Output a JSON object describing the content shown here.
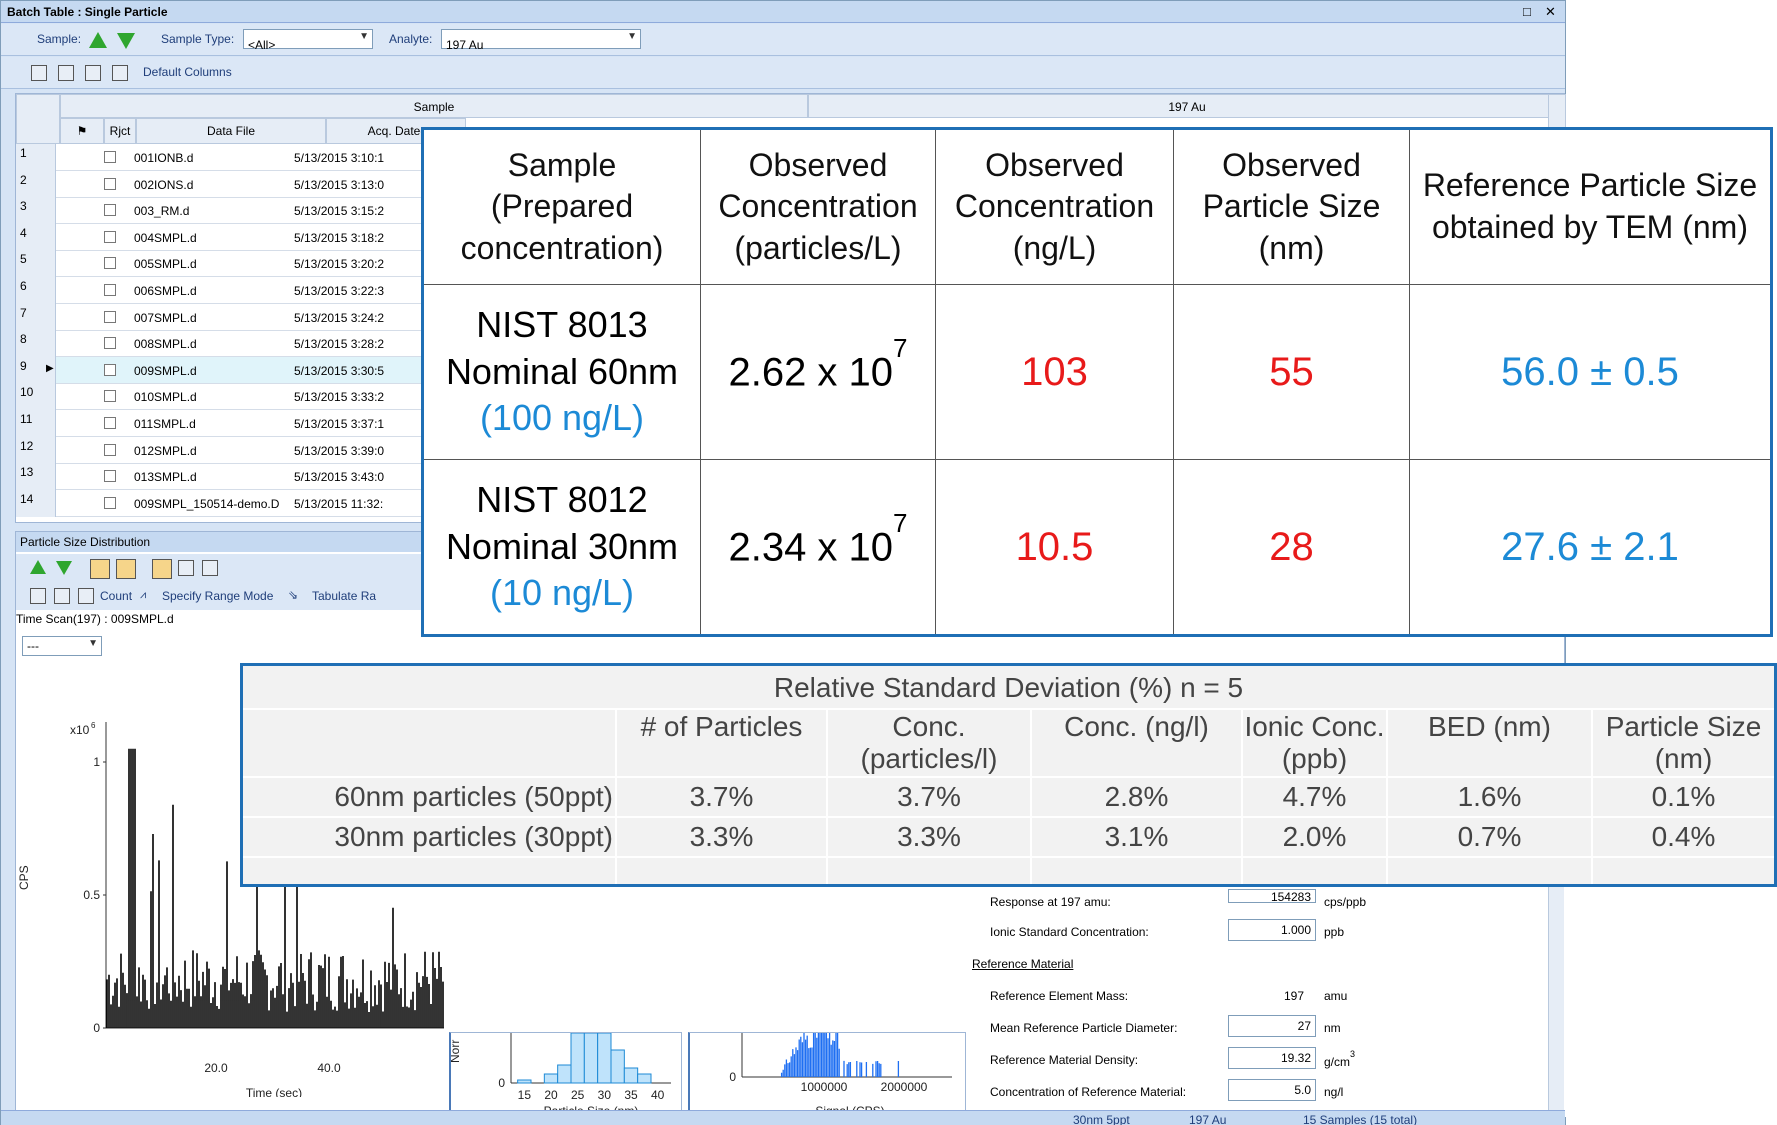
{
  "window": {
    "title": "Batch Table : Single Particle",
    "controls": {
      "restore": "□",
      "close": "✕"
    }
  },
  "toolbar1": {
    "sample_label": "Sample:",
    "sample_type_label": "Sample Type:",
    "sample_type_value": "<All>",
    "analyte_label": "Analyte:",
    "analyte_value": "197  Au"
  },
  "toolbar2": {
    "default_columns": "Default Columns"
  },
  "grid": {
    "group_sample": "Sample",
    "group_analyte": "197  Au",
    "col_rjct": "Rjct",
    "col_datafile": "Data File",
    "col_acqdate": "Acq. Date-",
    "rows": [
      {
        "n": "1",
        "file": "001IONB.d",
        "date": "5/13/2015 3:10:1"
      },
      {
        "n": "2",
        "file": "002IONS.d",
        "date": "5/13/2015 3:13:0"
      },
      {
        "n": "3",
        "file": "003_RM.d",
        "date": "5/13/2015 3:15:2"
      },
      {
        "n": "4",
        "file": "004SMPL.d",
        "date": "5/13/2015 3:18:2"
      },
      {
        "n": "5",
        "file": "005SMPL.d",
        "date": "5/13/2015 3:20:2"
      },
      {
        "n": "6",
        "file": "006SMPL.d",
        "date": "5/13/2015 3:22:3"
      },
      {
        "n": "7",
        "file": "007SMPL.d",
        "date": "5/13/2015 3:24:2"
      },
      {
        "n": "8",
        "file": "008SMPL.d",
        "date": "5/13/2015 3:28:2"
      },
      {
        "n": "9",
        "file": "009SMPL.d",
        "date": "5/13/2015 3:30:5"
      },
      {
        "n": "10",
        "file": "010SMPL.d",
        "date": "5/13/2015 3:33:2"
      },
      {
        "n": "11",
        "file": "011SMPL.d",
        "date": "5/13/2015 3:37:1"
      },
      {
        "n": "12",
        "file": "012SMPL.d",
        "date": "5/13/2015 3:39:0"
      },
      {
        "n": "13",
        "file": "013SMPL.d",
        "date": "5/13/2015 3:43:0"
      },
      {
        "n": "14",
        "file": "009SMPL_150514-demo.D",
        "date": "5/13/2015 11:32:"
      }
    ]
  },
  "psd": {
    "title": "Particle Size Distribution",
    "count_label": "Count",
    "range_mode_label": "Specify Range Mode",
    "tabulate_label": "Tabulate Ra",
    "scan_label": "Time Scan(197) : 009SMPL.d",
    "dropdown_value": "---"
  },
  "chart_data": [
    {
      "type": "bar",
      "ylabel": "CPS",
      "xlabel": "Time (sec)",
      "y_multiplier": "x10",
      "y_exponent": "6",
      "yticks": [
        "1",
        "0.5",
        "0"
      ],
      "xticks": [
        "20.0",
        "40.0"
      ]
    },
    {
      "type": "bar",
      "ylabel": "Norr",
      "xlabel": "Particle Size (nm)",
      "yticks": [
        "0"
      ],
      "xticks": [
        "15",
        "20",
        "25",
        "30",
        "35",
        "40"
      ],
      "categories": [
        15,
        20,
        22.5,
        25,
        27.5,
        30,
        32.5,
        35,
        37.5
      ],
      "values": [
        0.01,
        0.03,
        0.06,
        0.38,
        1.0,
        0.62,
        0.11,
        0.05,
        0.03
      ]
    },
    {
      "type": "bar",
      "xlabel": "Signal (CPS)",
      "yticks": [
        "0"
      ],
      "xticks": [
        "1000000",
        "2000000"
      ]
    }
  ],
  "method": {
    "response_label": "Response at 197 amu:",
    "response_value": "154283",
    "response_unit": "cps/ppb",
    "ionic_std_label": "Ionic Standard Concentration:",
    "ionic_std_value": "1.000",
    "ionic_std_unit": "ppb",
    "ref_material_label": "Reference Material",
    "ref_mass_label": "Reference Element Mass:",
    "ref_mass_value": "197",
    "ref_mass_unit": "amu",
    "ref_diam_label": "Mean Reference Particle Diameter:",
    "ref_diam_value": "27",
    "ref_diam_unit": "nm",
    "ref_density_label": "Reference Material Density:",
    "ref_density_value": "19.32",
    "ref_density_unit": "g/cm",
    "ref_density_exp": "3",
    "ref_conc_label": "Concentration of Reference Material:",
    "ref_conc_value": "5.0",
    "ref_conc_unit": "ng/l"
  },
  "statusbar": {
    "a": "30nm 5ppt",
    "b": "197  Au",
    "c": "15 Samples (15 total)"
  },
  "table1": {
    "headers": [
      "Sample\n(Prepared\nconcentration)",
      "Observed\nConcentration\n(particles/L)",
      "Observed\nConcentration\n(ng/L)",
      "Observed\nParticle Size\n(nm)",
      "Reference Particle Size\nobtained by TEM (nm)"
    ],
    "rows": [
      {
        "sample_l1": "NIST 8013",
        "sample_l2": "Nominal 60nm",
        "sample_l3": "(100 ng/L)",
        "conc_base": "2.62 x 10",
        "conc_exp": "7",
        "conc_ng": "103",
        "size": "55",
        "tem": "56.0 ± 0.5"
      },
      {
        "sample_l1": "NIST 8012",
        "sample_l2": "Nominal 30nm",
        "sample_l3": "(10 ng/L)",
        "conc_base": "2.34 x 10",
        "conc_exp": "7",
        "conc_ng": "10.5",
        "size": "28",
        "tem": "27.6 ± 2.1"
      }
    ]
  },
  "table2": {
    "title": "Relative Standard Deviation (%) n = 5",
    "headers": [
      "# of Particles",
      "Conc.\n(particles/l)",
      "Conc. (ng/l)",
      "Ionic Conc.\n(ppb)",
      "BED (nm)",
      "Particle Size\n(nm)"
    ],
    "rows": [
      {
        "label": "60nm particles (50ppt)",
        "values": [
          "3.7%",
          "3.7%",
          "2.8%",
          "4.7%",
          "1.6%",
          "0.1%"
        ]
      },
      {
        "label": "30nm particles (30ppt)",
        "values": [
          "3.3%",
          "3.3%",
          "3.1%",
          "2.0%",
          "0.7%",
          "0.4%"
        ]
      }
    ]
  },
  "colors": {
    "accent_blue": "#1c8ad6",
    "red": "#e81a1a",
    "frame_blue": "#1f6fb5"
  }
}
